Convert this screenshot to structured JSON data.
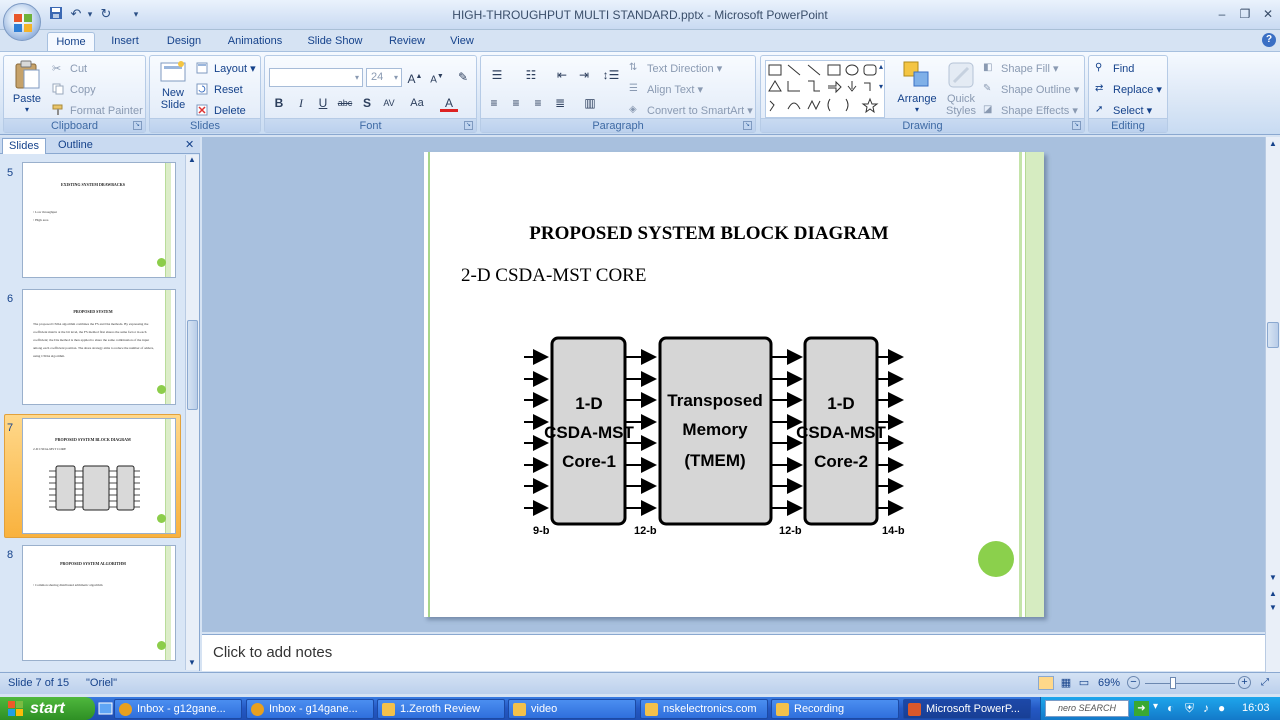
{
  "window": {
    "title": "HIGH-THROUGHPUT MULTI STANDARD.pptx - Microsoft PowerPoint"
  },
  "tabs": [
    {
      "label": "Home",
      "active": true
    },
    {
      "label": "Insert"
    },
    {
      "label": "Design"
    },
    {
      "label": "Animations"
    },
    {
      "label": "Slide Show"
    },
    {
      "label": "Review"
    },
    {
      "label": "View"
    }
  ],
  "ribbon": {
    "clipboard": {
      "label": "Clipboard",
      "paste": "Paste",
      "cut": "Cut",
      "copy": "Copy",
      "format_painter": "Format Painter"
    },
    "slides": {
      "label": "Slides",
      "new_slide_1": "New",
      "new_slide_2": "Slide",
      "layout": "Layout",
      "reset": "Reset",
      "delete": "Delete"
    },
    "font": {
      "label": "Font",
      "font_size": "24"
    },
    "paragraph": {
      "label": "Paragraph",
      "text_direction": "Text Direction",
      "align_text": "Align Text",
      "convert_smartart": "Convert to SmartArt"
    },
    "drawing": {
      "label": "Drawing",
      "arrange": "Arrange",
      "quick_styles_1": "Quick",
      "quick_styles_2": "Styles",
      "shape_fill": "Shape Fill",
      "shape_outline": "Shape Outline",
      "shape_effects": "Shape Effects"
    },
    "editing": {
      "label": "Editing",
      "find": "Find",
      "replace": "Replace",
      "select": "Select"
    }
  },
  "left_panel": {
    "tab_slides": "Slides",
    "tab_outline": "Outline",
    "thumbnails": [
      {
        "num": "5",
        "title": "EXISTING SYSTEM DRAWBACKS",
        "bullets": [
          "Low throughput",
          "High area"
        ]
      },
      {
        "num": "6",
        "title": "PROPOSED SYSTEM",
        "body": "The proposed CSDA algorithm combines the FS and DA methods. By expressing the coefficient matrix at the bit level, the FS method first shares the same factor in each coefficient; the DA method is then applied to share the same combination of the input among each coefficient position. The share strategy aims to reduce the number of adders, using CSDA algorithm."
      },
      {
        "num": "7",
        "title": "PROPOSED SYSTEM BLOCK DIAGRAM",
        "subtitle": "2-D CSDA-MST CORE",
        "selected": true
      },
      {
        "num": "8",
        "title": "PROPOSED SYSTEM ALGORITHM",
        "bullets": [
          "Common sharing distributed arithmetic algorithm"
        ]
      }
    ]
  },
  "slide": {
    "title": "PROPOSED SYSTEM BLOCK DIAGRAM",
    "subtitle": "2-D CSDA-MST CORE",
    "diagram": {
      "block1": [
        "1-D",
        "CSDA-MST",
        "Core-1"
      ],
      "block2": [
        "Transposed",
        "Memory",
        "(TMEM)"
      ],
      "block3": [
        "1-D",
        "CSDA-MST",
        "Core-2"
      ],
      "labels": [
        "9-b",
        "12-b",
        "12-b",
        "14-b"
      ]
    }
  },
  "notes": {
    "placeholder": "Click to add notes"
  },
  "statusbar": {
    "slide_info": "Slide 7 of 15",
    "theme": "\"Oriel\"",
    "zoom": "69%"
  },
  "taskbar": {
    "start": "start",
    "tasks": [
      {
        "label": "Inbox - g12gane...",
        "color": "#e8a020"
      },
      {
        "label": "Inbox - g14gane...",
        "color": "#e8a020"
      },
      {
        "label": "1.Zeroth Review",
        "color": "#f3c14b"
      },
      {
        "label": "video",
        "color": "#f3c14b"
      },
      {
        "label": "nskelectronics.com",
        "color": "#f3c14b"
      },
      {
        "label": "Recording",
        "color": "#f3c14b"
      },
      {
        "label": "Microsoft PowerP...",
        "color": "#d9582b",
        "active": true
      }
    ],
    "tray_app": "nero SEARCH",
    "clock": "16:03"
  },
  "colors": {
    "accent": "#8bd04c",
    "ribbon_text": "#15428b"
  }
}
